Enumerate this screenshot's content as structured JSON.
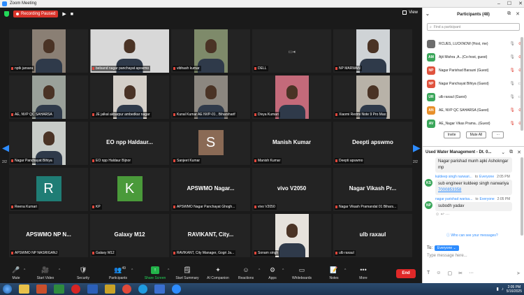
{
  "window": {
    "title": "Zoom Meeting",
    "controls": [
      "–",
      "☐",
      "✕"
    ]
  },
  "topbar": {
    "recording_label": "Recording Paused",
    "view_label": "View"
  },
  "pagination": {
    "left": "2/2",
    "right": "2/2"
  },
  "tiles": [
    {
      "kind": "video",
      "name": "nptk jarsara",
      "bg": "#8a7f74"
    },
    {
      "kind": "video",
      "name": "belsand nagar panchayat  apswmo",
      "bg": "#d8d8d8"
    },
    {
      "kind": "video",
      "name": "vibhash kumar",
      "bg": "#7e8a6a"
    },
    {
      "kind": "camoff",
      "name": "DELL"
    },
    {
      "kind": "video",
      "name": "NP MARWAN",
      "bg": "#cfd3d6"
    },
    {
      "kind": "video",
      "name": "AE, NVP QC SAHARSA",
      "bg": "#9aa19a"
    },
    {
      "kind": "video",
      "name": "JE jalkal akbarpur ambedkar nagar",
      "bg": "#d4cfc8"
    },
    {
      "kind": "video",
      "name": "Kunal Kumar AE NVP-01 , Biharsharif",
      "bg": "#8c8780"
    },
    {
      "kind": "video",
      "name": "Divya Kumari",
      "bg": "#c46a7a"
    },
    {
      "kind": "video",
      "name": "Xiaomi Redmi Note 9 Pro Max",
      "bg": "#b8b2a8"
    },
    {
      "kind": "video",
      "name": "Nagar Panchayat Bihiya",
      "bg": "#c8ccc8"
    },
    {
      "kind": "label",
      "name": "EO npp Haldaur Bijnor",
      "big": "EO npp Haldaur..."
    },
    {
      "kind": "avatar",
      "name": "Sanjeet Kumar",
      "letter": "S",
      "color": "#8a6a55"
    },
    {
      "kind": "label",
      "name": "Manish Kumar",
      "big": "Manish Kumar"
    },
    {
      "kind": "label",
      "name": "Deepti apswmo",
      "big": "Deepti apswmo"
    },
    {
      "kind": "avatar",
      "name": "Reena Kumari",
      "letter": "R",
      "color": "#1f7d75"
    },
    {
      "kind": "avatar",
      "name": "KP",
      "letter": "K",
      "color": "#4a9a3a"
    },
    {
      "kind": "label",
      "name": "APSWMO Nagar Panchayat Ghogh...",
      "big": "APSWMO  Nagar..."
    },
    {
      "kind": "label",
      "name": "vivo V2050",
      "big": "vivo V2050"
    },
    {
      "kind": "label",
      "name": "Nagar Vikash Pramandal 01 Bihars...",
      "big": "Nagar Vikash Pr..."
    },
    {
      "kind": "label",
      "name": "APSWMO NP NASRIGANJ",
      "big": "APSWMO NP N..."
    },
    {
      "kind": "label",
      "name": "Galaxy M12",
      "big": "Galaxy M12"
    },
    {
      "kind": "label",
      "name": "RAVIKANT, City Manager, Gogri  Ja...",
      "big": "RAVIKANT,  City..."
    },
    {
      "kind": "video",
      "name": "Sonam singh",
      "bg": "#e6e2dc"
    },
    {
      "kind": "label",
      "name": "ulb raxaul",
      "big": "ulb raxaul"
    }
  ],
  "toolbar": {
    "mute": "Mute",
    "video": "Start Video",
    "security": "Security",
    "participants": "Participants",
    "participants_count": "49",
    "share": "Share Screen",
    "summary": "Start Summary",
    "companion": "AI Companion",
    "reactions": "Reactions",
    "apps": "Apps",
    "whiteboards": "Whiteboards",
    "notes": "Notes",
    "more": "More",
    "end": "End"
  },
  "participants_panel": {
    "title": "Participants (48)",
    "search_placeholder": "Find a participant",
    "list": [
      {
        "initials": "",
        "name": "RCUES, LUCKNOW (Host, me)",
        "color": "#6d6d6d",
        "mic_red": false,
        "cam_red": true
      },
      {
        "initials": "AM",
        "name": "Ajit Mishra ,A...(Co-host, guest)",
        "color": "#3aa65a",
        "mic_red": false,
        "cam_red": true
      },
      {
        "initials": "NP",
        "name": "Nagar Parishad Barauni (Guest)",
        "color": "#e0533e",
        "mic_red": true,
        "cam_red": true
      },
      {
        "initials": "NP",
        "name": "Nagar Panchayat Bihiya (Guest)",
        "color": "#e0533e",
        "mic_red": false,
        "cam_red": false
      },
      {
        "initials": "UR",
        "name": "ulb raxaul (Guest)",
        "color": "#3aa65a",
        "mic_red": false,
        "cam_red": false
      },
      {
        "initials": "AN",
        "name": "AE, NVP QC SAHARSA (Guest)",
        "color": "#e8902b",
        "mic_red": true,
        "cam_red": true
      },
      {
        "initials": "AV",
        "name": "AE_Nagar Vikas Prama...(Guest)",
        "color": "#3aa65a",
        "mic_red": true,
        "cam_red": true
      }
    ],
    "invite": "Invite",
    "mute_all": "Mute All",
    "more": "···"
  },
  "chat": {
    "title": "Used Water Management - Dt. 0...",
    "first_bubble": "Nagar parishad munh apki Ashokngar mp",
    "messages": [
      {
        "initials": "KS",
        "color": "#3aa65a",
        "sender": "kuldeep singh narwari...",
        "to": "to",
        "recipient": "Everyone",
        "time": "2:05 PM",
        "text": "sub engineer kuldeep singh narwariya",
        "link": "7000853358"
      },
      {
        "initials": "NP",
        "color": "#3aa65a",
        "sender": "nagar parishad warisa...",
        "to": "to",
        "recipient": "Everyone",
        "time": "2:05 PM",
        "text": "subodh yadav",
        "link": ""
      }
    ],
    "who_can_see": "Who can see your messages?",
    "to_label": "To:",
    "recipient": "Everyone",
    "input_placeholder": "Type message here..."
  },
  "taskbar": {
    "time": "2:05 PM",
    "date": "5/16/2025"
  }
}
